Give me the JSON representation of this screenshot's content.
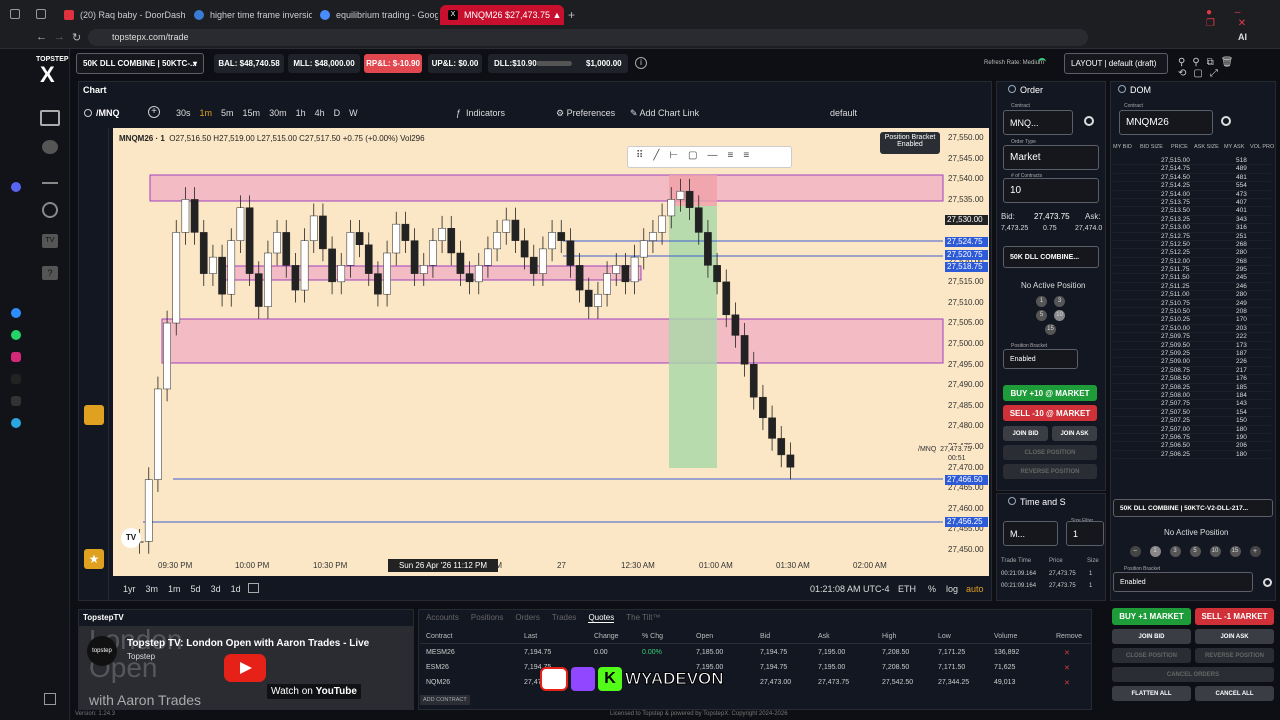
{
  "browser": {
    "tabs": [
      {
        "title": "(20) Raq baby - DoorDash",
        "color": "#e0323e"
      },
      {
        "title": "higher time frame inversio",
        "color": "#3a7bd5"
      },
      {
        "title": "equilibrium trading - Goog",
        "color": "#4a8cff"
      },
      {
        "title": "MNQM26 $27,473.75 ▲",
        "color": "#000000"
      }
    ],
    "url": "topstepx.com/trade",
    "ai_label": "AI"
  },
  "brand": {
    "name": "TOPSTEP",
    "logo": "X"
  },
  "account_bar": {
    "account": "50K DLL COMBINE | 50KTC-...",
    "bal": "BAL: $48,740.58",
    "mll": "MLL: $48,000.00",
    "rpl": "RP&L: $-10.90",
    "upl": "UP&L: $0.00",
    "dll": "DLL:$10.90",
    "dll_limit": "$1,000.00",
    "refresh": "Refresh Rate: Medium",
    "layout": "LAYOUT | default (draft)"
  },
  "chart": {
    "panel_title": "Chart",
    "symbol": "/MNQ",
    "timeframes": [
      "30s",
      "1m",
      "5m",
      "15m",
      "30m",
      "1h",
      "4h",
      "D",
      "W"
    ],
    "active_tf": "1m",
    "indicators_label": "Indicators",
    "preferences_label": "Preferences",
    "add_link_label": "Add Chart Link",
    "template": "default",
    "legend": "MNQM26 · 1",
    "ohlc": "O27,516.50  H27,519.00  L27,515.00  C27,517.50  +0.75 (+0.00%)  Vol296",
    "bracket": {
      "title": "Position Bracket",
      "state": "Enabled"
    },
    "price_labels": [
      "27,550.00",
      "27,545.00",
      "27,540.00",
      "27,535.00",
      "27,530.00",
      "27,525.00",
      "27,520.00",
      "27,515.00",
      "27,510.00",
      "27,505.00",
      "27,500.00",
      "27,495.00",
      "27,490.00",
      "27,485.00",
      "27,480.00",
      "27,475.00",
      "27,470.00",
      "27,465.00",
      "27,460.00",
      "27,455.00",
      "27,450.00"
    ],
    "price_tags": {
      "cross": "27,530.00",
      "p1": "27,524.75",
      "p2": "27,520.75",
      "p3": "27,518.75",
      "p4": "27,466.50",
      "p5": "27,456.25"
    },
    "last": {
      "symbol": "/MNQ",
      "price": "27,473.75",
      "timer": "00:51"
    },
    "time_labels": [
      "09:30 PM",
      "10:00 PM",
      "10:30 PM",
      "PM",
      "27",
      "12:30 AM",
      "01:00 AM",
      "01:30 AM",
      "02:00 AM"
    ],
    "time_cursor": "Sun 26 Apr '26   11:12 PM",
    "ranges": [
      "1yr",
      "3m",
      "1m",
      "5d",
      "3d",
      "1d"
    ],
    "clock": "01:21:08 AM UTC-4",
    "session": "ETH",
    "pct": "%",
    "log": "log",
    "auto": "auto",
    "closes": [
      27455,
      27470,
      27492,
      27508,
      27530,
      27538,
      27530,
      27520,
      27524,
      27515,
      27528,
      27536,
      27520,
      27512,
      27525,
      27530,
      27522,
      27516,
      27528,
      27534,
      27526,
      27518,
      27522,
      27530,
      27527,
      27520,
      27515,
      27525,
      27532,
      27528,
      27520,
      27522,
      27528,
      27531,
      27525,
      27520,
      27518,
      27522,
      27526,
      27530,
      27533,
      27528,
      27524,
      27520,
      27526,
      27530,
      27528,
      27522,
      27516,
      27512,
      27515,
      27520,
      27522,
      27518,
      27524,
      27528,
      27530,
      27534,
      27538,
      27540,
      27536,
      27530,
      27522,
      27518,
      27510,
      27505,
      27498,
      27490,
      27485,
      27480,
      27476,
      27473
    ]
  },
  "order_panel": {
    "title": "Order",
    "contract_label": "Contract",
    "contract": "MNQ...",
    "order_type_label": "Order Type",
    "order_type": "Market",
    "contracts_label": "# of Contracts",
    "contracts": "10",
    "bid_label": "Bid:",
    "bid": "27,473.75",
    "ask_label": "Ask:",
    "bid_size": "7,473.25",
    "spread": "0.75",
    "ask": "27,474.0",
    "account": "50K DLL COMBINE...",
    "position": "No Active Position",
    "qty": [
      "1",
      "3",
      "5",
      "10",
      "15"
    ],
    "bracket_label": "Position Bracket",
    "bracket": "Enabled",
    "buy": "BUY +10 @ MARKET",
    "sell": "SELL -10 @ MARKET",
    "join_bid": "JOIN BID",
    "join_ask": "JOIN ASK",
    "close": "CLOSE POSITION",
    "reverse": "REVERSE POSITION"
  },
  "time_sales": {
    "title": "Time and S",
    "contract": "M...",
    "size_filter_label": "Size Filter",
    "size_filter": "1",
    "headers": [
      "Trade Time",
      "Price",
      "Size"
    ],
    "rows": [
      [
        "00:21:09.164",
        "27,473.75",
        "1"
      ],
      [
        "00:21:09.164",
        "27,473.75",
        "1"
      ]
    ]
  },
  "dom": {
    "title": "DOM",
    "contract_label": "Contract",
    "contract": "MNQM26",
    "headers": [
      "MY BID",
      "BID SIZE",
      "PRICE",
      "ASK SIZE",
      "MY ASK",
      "VOL PRO"
    ],
    "rows": [
      [
        "27,515.00",
        "518"
      ],
      [
        "27,514.75",
        "489"
      ],
      [
        "27,514.50",
        "481"
      ],
      [
        "27,514.25",
        "554"
      ],
      [
        "27,514.00",
        "473"
      ],
      [
        "27,513.75",
        "407"
      ],
      [
        "27,513.50",
        "401"
      ],
      [
        "27,513.25",
        "343"
      ],
      [
        "27,513.00",
        "316"
      ],
      [
        "27,512.75",
        "251"
      ],
      [
        "27,512.50",
        "268"
      ],
      [
        "27,512.25",
        "280"
      ],
      [
        "27,512.00",
        "268"
      ],
      [
        "27,511.75",
        "295"
      ],
      [
        "27,511.50",
        "245"
      ],
      [
        "27,511.25",
        "246"
      ],
      [
        "27,511.00",
        "280"
      ],
      [
        "27,510.75",
        "249"
      ],
      [
        "27,510.50",
        "208"
      ],
      [
        "27,510.25",
        "170"
      ],
      [
        "27,510.00",
        "203"
      ],
      [
        "27,509.75",
        "222"
      ],
      [
        "27,509.50",
        "173"
      ],
      [
        "27,509.25",
        "187"
      ],
      [
        "27,509.00",
        "226"
      ],
      [
        "27,508.75",
        "217"
      ],
      [
        "27,508.50",
        "176"
      ],
      [
        "27,508.25",
        "185"
      ],
      [
        "27,508.00",
        "184"
      ],
      [
        "27,507.75",
        "143"
      ],
      [
        "27,507.50",
        "154"
      ],
      [
        "27,507.25",
        "150"
      ],
      [
        "27,507.00",
        "180"
      ],
      [
        "27,506.75",
        "190"
      ],
      [
        "27,506.50",
        "206"
      ],
      [
        "27,506.25",
        "180"
      ]
    ],
    "account": "50K DLL COMBINE | 50KTC-V2-DLL-217...",
    "position": "No Active Position",
    "qty": [
      "1",
      "3",
      "5",
      "10",
      "15"
    ],
    "bracket_label": "Position Bracket",
    "bracket": "Enabled",
    "buy": "BUY +1 MARKET",
    "sell": "SELL -1 MARKET",
    "join_bid": "JOIN BID",
    "join_ask": "JOIN ASK",
    "close": "CLOSE POSITION",
    "reverse": "REVERSE POSITION",
    "cancel": "CANCEL ORDERS",
    "flatten": "FLATTEN ALL",
    "cancel_all": "CANCEL ALL"
  },
  "video": {
    "panel": "TopstepTV",
    "title": "Topstep TV: London Open with Aaron Trades - Live",
    "channel": "Topstep",
    "bg_text_1": "London",
    "bg_text_2": "Open",
    "bg_text_3": "with Aaron Trades",
    "watch": "Watch on",
    "yt": "YouTube"
  },
  "quotes": {
    "tabs": [
      "Accounts",
      "Positions",
      "Orders",
      "Trades",
      "Quotes",
      "The Tilt™"
    ],
    "active": "Quotes",
    "headers": [
      "Contract",
      "Last",
      "Change",
      "% Chg",
      "Open",
      "Bid",
      "Ask",
      "High",
      "Low",
      "Volume",
      "Remove"
    ],
    "rows": [
      [
        "MESM26",
        "7,194.75",
        "0.00",
        "0.00%",
        "7,185.00",
        "7,194.75",
        "7,195.00",
        "7,208.50",
        "7,171.25",
        "136,892"
      ],
      [
        "ESM26",
        "7,194.75",
        "",
        "",
        "7,195.00",
        "7,194.75",
        "7,195.00",
        "7,208.50",
        "7,171.50",
        "71,625"
      ],
      [
        "NQM26",
        "27,47...",
        "",
        "",
        "",
        "27,473.00",
        "27,473.75",
        "27,542.50",
        "27,344.25",
        "49,013"
      ]
    ],
    "add_contract": "ADD CONTRACT"
  },
  "overlay": {
    "handle": "WYADEVON"
  },
  "footer": {
    "version": "Version: 1.24.3",
    "license": "Licensed to Topstep & powered by TopstepX. Copyright 2024-2026"
  }
}
